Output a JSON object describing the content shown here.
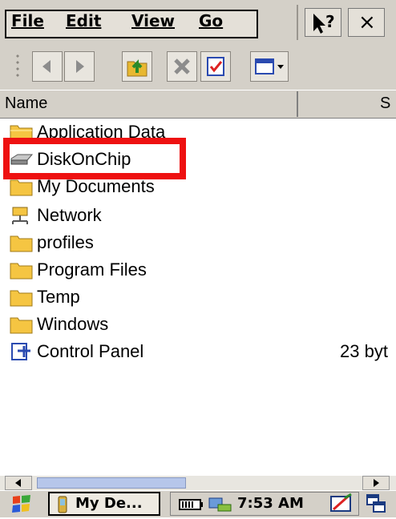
{
  "menu": {
    "items": [
      {
        "label": "File"
      },
      {
        "label": "Edit"
      },
      {
        "label": "View"
      },
      {
        "label": "Go"
      }
    ],
    "help_icon": "help-question-icon",
    "close_label": "×"
  },
  "toolbar": {
    "buttons": [
      {
        "icon": "back-arrow-icon"
      },
      {
        "icon": "forward-arrow-icon"
      },
      {
        "icon": "up-folder-icon"
      },
      {
        "icon": "delete-x-icon"
      },
      {
        "icon": "properties-icon"
      },
      {
        "icon": "view-menu-icon"
      }
    ]
  },
  "columns": {
    "name": "Name",
    "size": "S"
  },
  "files": [
    {
      "name": "Application Data",
      "icon": "folder-icon",
      "size": ""
    },
    {
      "name": "DiskOnChip",
      "icon": "disk-drive-icon",
      "size": ""
    },
    {
      "name": "My Documents",
      "icon": "folder-icon",
      "size": ""
    },
    {
      "name": "Network",
      "icon": "network-icon",
      "size": ""
    },
    {
      "name": "profiles",
      "icon": "folder-icon",
      "size": ""
    },
    {
      "name": "Program Files",
      "icon": "folder-icon",
      "size": ""
    },
    {
      "name": "Temp",
      "icon": "folder-icon",
      "size": ""
    },
    {
      "name": "Windows",
      "icon": "folder-icon",
      "size": ""
    },
    {
      "name": "Control Panel",
      "icon": "control-panel-icon",
      "size": "23 byt"
    }
  ],
  "taskbar": {
    "start_icon": "windows-flag-icon",
    "task_label": "My De...",
    "clock": "7:53 AM",
    "tray_icons": [
      "battery-icon",
      "network-connected-icon",
      "input-panel-icon",
      "windows-switch-icon"
    ]
  },
  "colors": {
    "highlight_border": "#ee1111",
    "chrome": "#d4d0c8",
    "folder": "#f5c542"
  }
}
